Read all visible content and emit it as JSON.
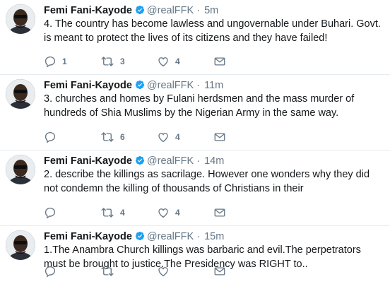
{
  "tweets": [
    {
      "name": "Femi Fani-Kayode",
      "handle": "@realFFK",
      "dot": "·",
      "time": "5m",
      "text": "4. The country has become lawless and ungovernable under Buhari. Govt. is meant to protect the lives of its citizens and they have failed!",
      "replies": "1",
      "retweets": "3",
      "likes": "4"
    },
    {
      "name": "Femi Fani-Kayode",
      "handle": "@realFFK",
      "dot": "·",
      "time": "11m",
      "text": "3. churches and homes by Fulani herdsmen and the mass murder of hundreds of Shia Muslims by the Nigerian Army in the same way.",
      "replies": "",
      "retweets": "6",
      "likes": "4"
    },
    {
      "name": "Femi Fani-Kayode",
      "handle": "@realFFK",
      "dot": "·",
      "time": "14m",
      "text": "2. describe the killings as sacrilage. However one wonders why they did not condemn the killing of thousands of Christians in their",
      "replies": "",
      "retweets": "4",
      "likes": "4"
    },
    {
      "name": "Femi Fani-Kayode",
      "handle": "@realFFK",
      "dot": "·",
      "time": "15m",
      "text": "1.The Anambra Church killings was barbaric and evil.The perpetrators must be brought to justice.The Presidency was RIGHT to..",
      "replies": "",
      "retweets": "",
      "likes": ""
    }
  ],
  "colors": {
    "verified": "#1da1f2",
    "icon": "#657786",
    "divider": "#e6ecf0"
  },
  "icons": [
    "reply-icon",
    "retweet-icon",
    "like-icon",
    "direct-message-icon",
    "verified-badge-icon"
  ]
}
